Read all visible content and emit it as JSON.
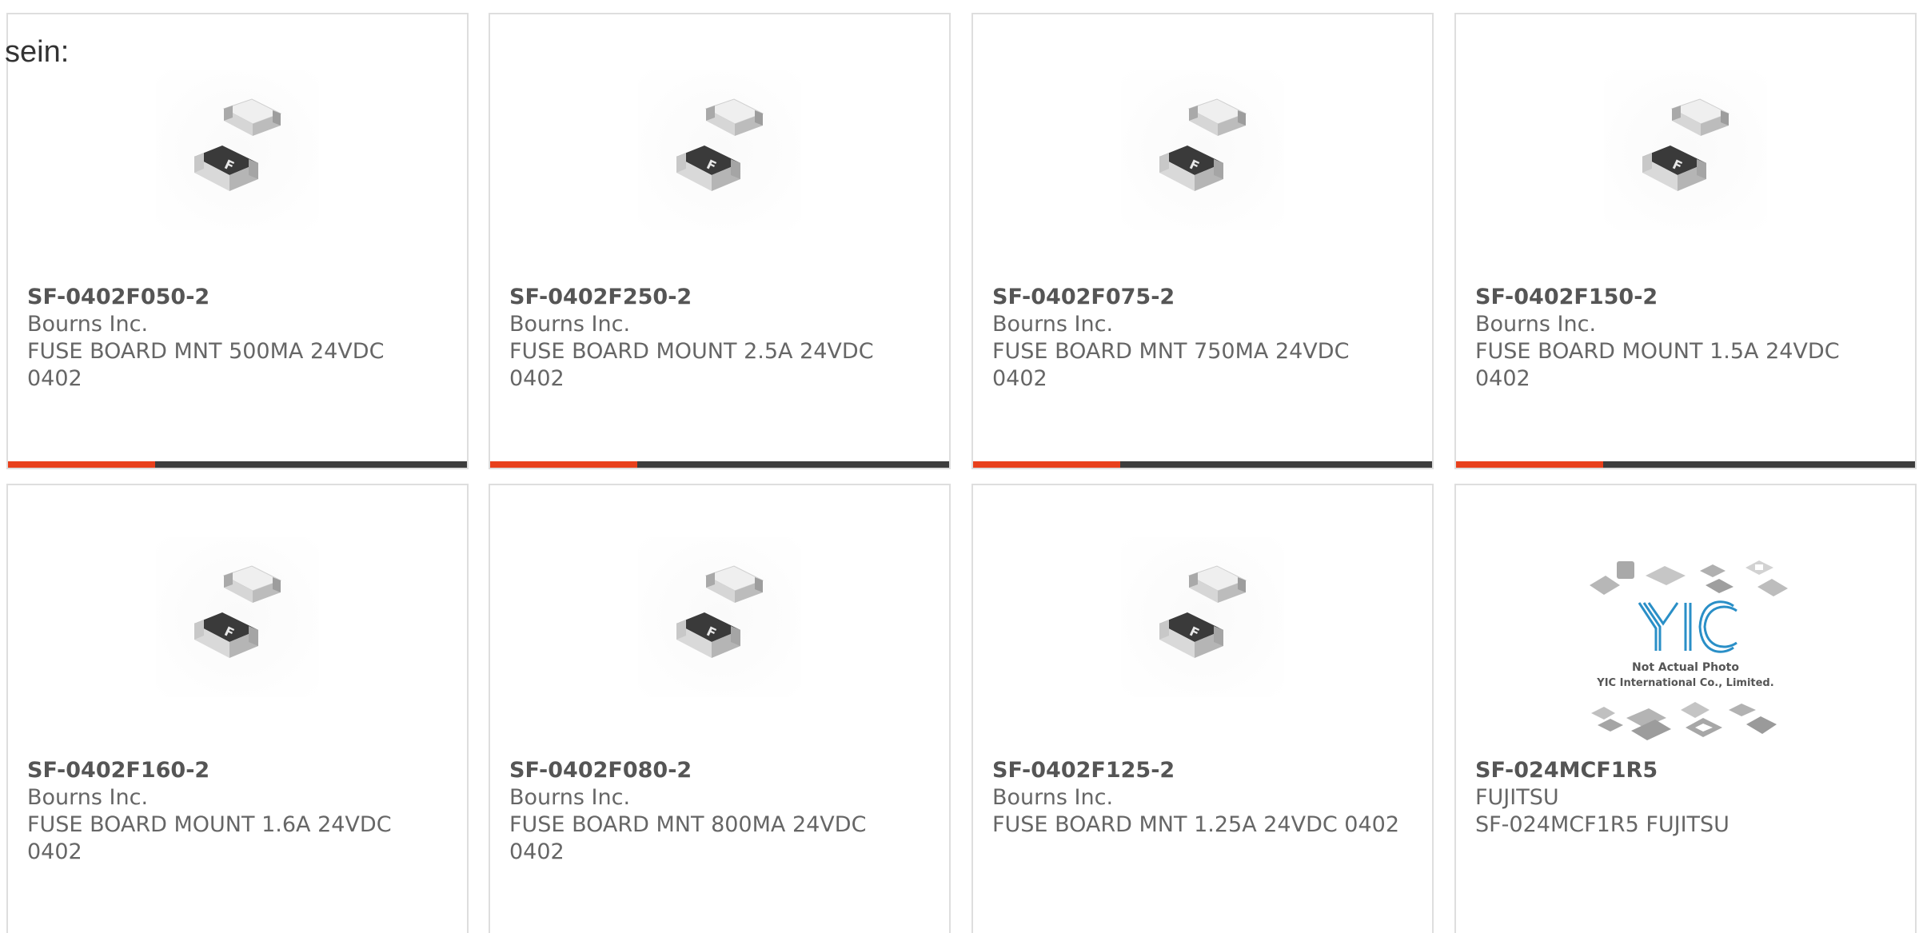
{
  "intro_text": "sein:",
  "accent_color": "#e8401c",
  "bar_color": "#3d3d3d",
  "cards": [
    {
      "part": "SF-0402F050-2",
      "manufacturer": "Bourns Inc.",
      "description": "FUSE BOARD MNT 500MA 24VDC 0402",
      "image": "smd-fuse-chip-photo"
    },
    {
      "part": "SF-0402F250-2",
      "manufacturer": "Bourns Inc.",
      "description": "FUSE BOARD MOUNT 2.5A 24VDC 0402",
      "image": "smd-fuse-chip-photo"
    },
    {
      "part": "SF-0402F075-2",
      "manufacturer": "Bourns Inc.",
      "description": "FUSE BOARD MNT 750MA 24VDC 0402",
      "image": "smd-fuse-chip-photo"
    },
    {
      "part": "SF-0402F150-2",
      "manufacturer": "Bourns Inc.",
      "description": "FUSE BOARD MOUNT 1.5A 24VDC 0402",
      "image": "smd-fuse-chip-photo"
    },
    {
      "part": "SF-0402F160-2",
      "manufacturer": "Bourns Inc.",
      "description": "FUSE BOARD MOUNT 1.6A 24VDC 0402",
      "image": "smd-fuse-chip-photo"
    },
    {
      "part": "SF-0402F080-2",
      "manufacturer": "Bourns Inc.",
      "description": "FUSE BOARD MNT 800MA 24VDC 0402",
      "image": "smd-fuse-chip-photo"
    },
    {
      "part": "SF-0402F125-2",
      "manufacturer": "Bourns Inc.",
      "description": "FUSE BOARD MNT 1.25A 24VDC 0402",
      "image": "smd-fuse-chip-photo"
    },
    {
      "part": "SF-024MCF1R5",
      "manufacturer": "FUJITSU",
      "description": "SF-024MCF1R5 FUJITSU",
      "image": "yic-placeholder-logo"
    }
  ],
  "placeholder_image": {
    "logo_text": "YIC",
    "line1": "Not Actual Photo",
    "line2": "YIC International Co., Limited."
  },
  "hover_progress": [
    0.32,
    0.32,
    0.32,
    0.32
  ]
}
